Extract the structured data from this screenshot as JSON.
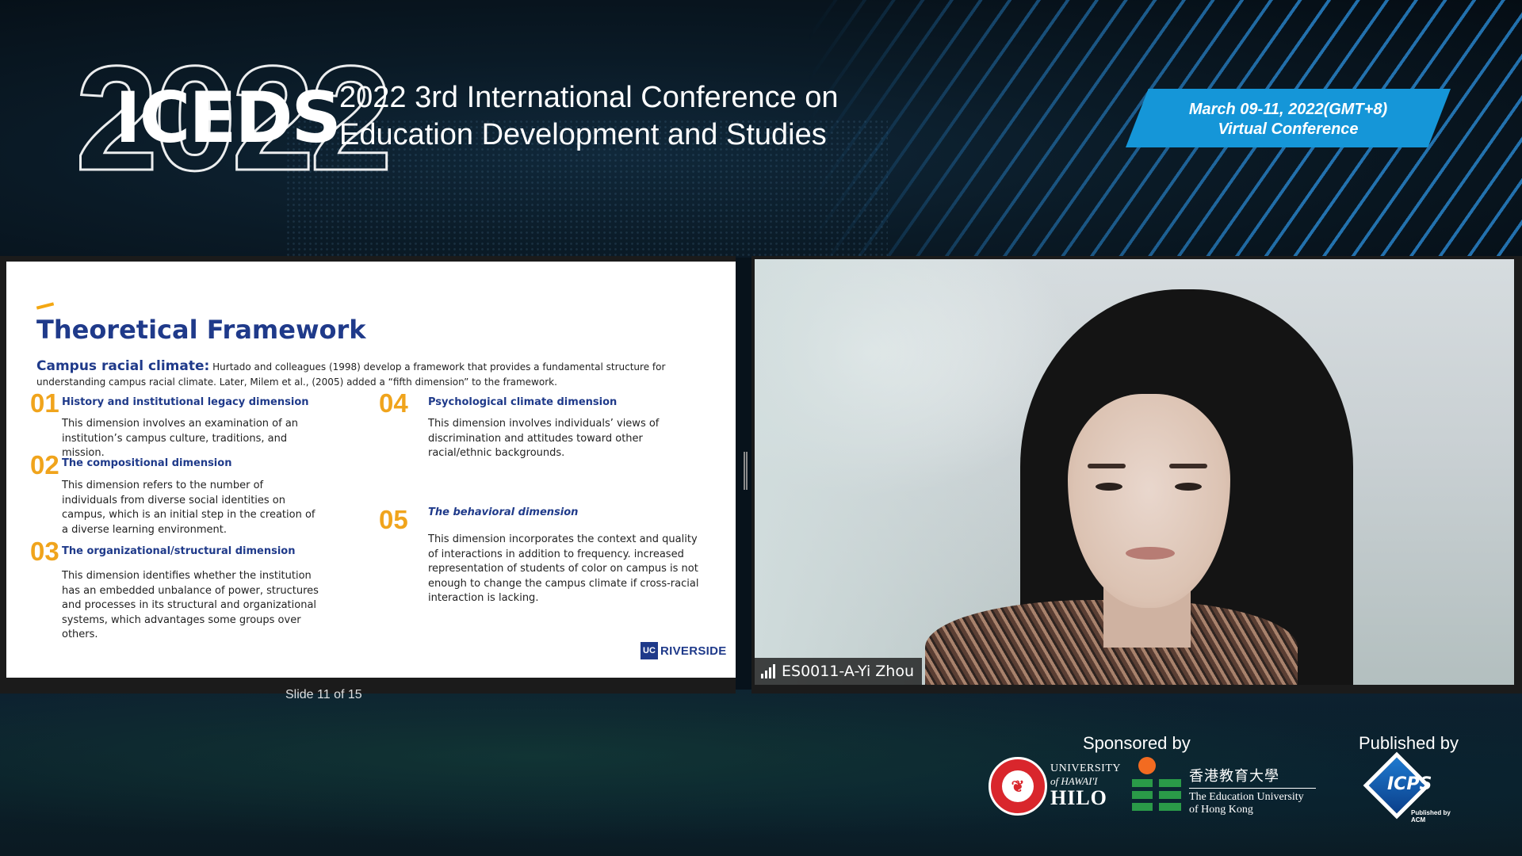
{
  "header": {
    "year": "2022",
    "brand": "ICEDS",
    "title_line1": "2022 3rd International Conference on",
    "title_line2": "Education Development and Studies",
    "date": "March 09-11, 2022(GMT+8)",
    "mode": "Virtual Conference",
    "accent_color": "#1596d8"
  },
  "slide": {
    "title": "Theoretical Framework",
    "intro_lead": "Campus racial climate:",
    "intro_text": " Hurtado and colleagues (1998) develop a framework that provides a fundamental structure for understanding campus racial climate. Later, Milem et al., (2005) added a “fifth dimension” to the framework.",
    "dimensions": [
      {
        "num": "01",
        "title": "History and institutional legacy dimension",
        "text": "This dimension involves an examination of an institution’s campus culture, traditions, and mission."
      },
      {
        "num": "02",
        "title": "The compositional dimension",
        "text": "This dimension refers to the number of individuals from diverse social identities on campus, which is an initial step in the creation of a diverse learning environment."
      },
      {
        "num": "03",
        "title": "The organizational/structural dimension",
        "text": "This dimension identifies whether the institution has an embedded unbalance of power, structures and processes in its structural and organizational systems, which advantages some groups over others."
      },
      {
        "num": "04",
        "title": "Psychological climate dimension",
        "text": "This dimension involves individuals’ views of discrimination and attitudes toward other racial/ethnic backgrounds."
      },
      {
        "num": "05",
        "title": "The behavioral dimension",
        "text": "This dimension incorporates the context and quality of interactions in addition to frequency. increased representation of students of color on campus is not enough to change the campus climate if cross-racial interaction is lacking."
      }
    ],
    "logo_box": "UC",
    "logo_text": "RIVERSIDE",
    "counter": "Slide 11 of 15",
    "title_color": "#1f3a8a",
    "number_color": "#f0a41c"
  },
  "video": {
    "participant_name": "ES0011-A-Yi Zhou",
    "signal_icon": "signal-bars-icon"
  },
  "footer": {
    "sponsored_label": "Sponsored by",
    "published_label": "Published by",
    "uh_line1": "UNIVERSITY",
    "uh_line2": "of HAWAI'I",
    "uh_line3": "HILO",
    "uh_seal": "❦",
    "eduhk_cn": "香港教育大學",
    "eduhk_en1": "The Education University",
    "eduhk_en2": "of Hong Kong",
    "icps_label": "ICPS",
    "icps_sub": "Published by ACM"
  }
}
